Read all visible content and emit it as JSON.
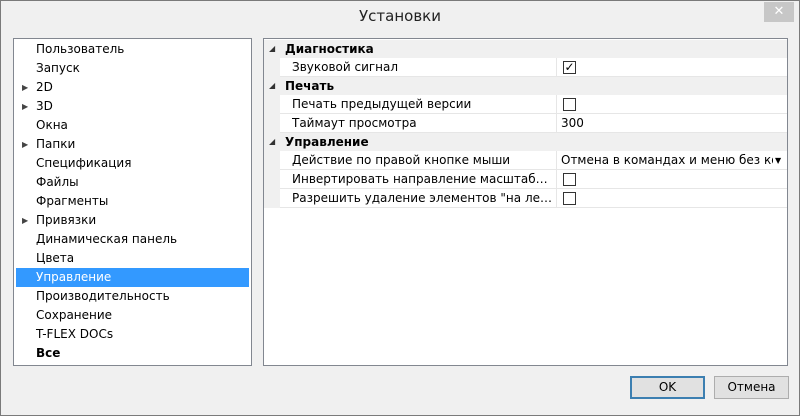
{
  "window": {
    "title": "Установки",
    "close_label": "✕"
  },
  "sidebar": {
    "items": [
      {
        "label": "Пользователь",
        "expandable": false
      },
      {
        "label": "Запуск",
        "expandable": false
      },
      {
        "label": "2D",
        "expandable": true
      },
      {
        "label": "3D",
        "expandable": true
      },
      {
        "label": "Окна",
        "expandable": false
      },
      {
        "label": "Папки",
        "expandable": true
      },
      {
        "label": "Спецификация",
        "expandable": false
      },
      {
        "label": "Файлы",
        "expandable": false
      },
      {
        "label": "Фрагменты",
        "expandable": false
      },
      {
        "label": "Привязки",
        "expandable": true
      },
      {
        "label": "Динамическая панель",
        "expandable": false
      },
      {
        "label": "Цвета",
        "expandable": false
      },
      {
        "label": "Управление",
        "expandable": false,
        "selected": true
      },
      {
        "label": "Производительность",
        "expandable": false
      },
      {
        "label": "Сохранение",
        "expandable": false
      },
      {
        "label": "T-FLEX DOCs",
        "expandable": false
      },
      {
        "label": "Все",
        "expandable": false,
        "bold": true
      }
    ]
  },
  "properties": {
    "categories": [
      {
        "label": "Диагностика",
        "rows": [
          {
            "name": "Звуковой сигнал",
            "type": "checkbox",
            "checked": true
          }
        ]
      },
      {
        "label": "Печать",
        "rows": [
          {
            "name": "Печать предыдущей версии",
            "type": "checkbox",
            "checked": false
          },
          {
            "name": "Таймаут просмотра",
            "type": "text",
            "value": "300"
          }
        ]
      },
      {
        "label": "Управление",
        "rows": [
          {
            "name": "Действие по правой кнопке мыши",
            "type": "dropdown",
            "value": "Отмена в командах и меню без коман,"
          },
          {
            "name": "Инвертировать направление масштабирован...",
            "type": "checkbox",
            "checked": false
          },
          {
            "name": "Разрешить удаление элементов \"на лету\"",
            "type": "checkbox",
            "checked": false
          }
        ]
      }
    ]
  },
  "buttons": {
    "ok": "OK",
    "cancel": "Отмена"
  },
  "icons": {
    "expand": "triangle-right",
    "collapse": "triangle-collapsed",
    "dropdown": "triangle-down",
    "check": "checkmark"
  },
  "colors": {
    "selection": "#3399ff",
    "category_bg": "#f0f0f0",
    "default_button_border": "#3c7fb1"
  }
}
